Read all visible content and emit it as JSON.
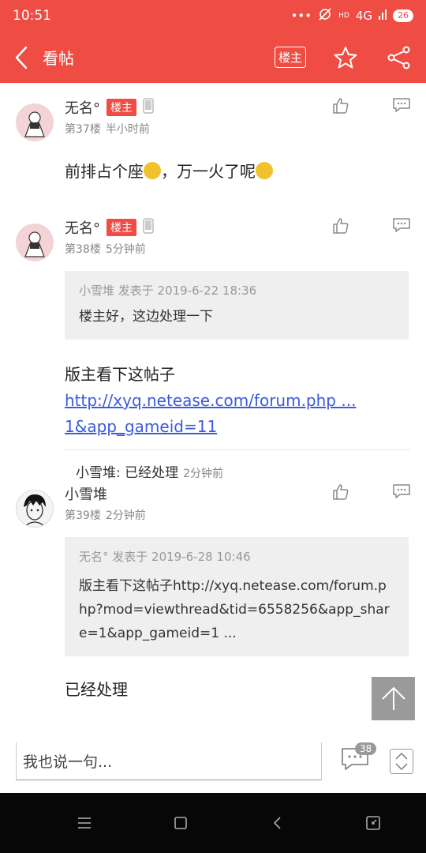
{
  "status": {
    "time": "10:51",
    "network": "4G",
    "battery": "26",
    "icons": [
      "dots-icon",
      "mute-alarm-icon",
      "hd-icon",
      "signal-icon",
      "battery-icon"
    ]
  },
  "header": {
    "title": "看帖",
    "louzhu_label": "楼主",
    "icons": [
      "back-icon",
      "star-icon",
      "share-icon"
    ],
    "color": "#ef4c44"
  },
  "posts": [
    {
      "name": "无名°",
      "badge": "楼主",
      "floor": "第37楼",
      "time": "半小时前",
      "text_a": "前排占个座",
      "text_b": "，万一火了呢"
    },
    {
      "name": "无名°",
      "badge": "楼主",
      "floor": "第38楼",
      "time": "5分钟前",
      "quote_head": "小雪堆 发表于 2019-6-22 18:36",
      "quote_body": "楼主好，这边处理一下",
      "text_prefix": "版主看下这帖子",
      "link": "http://xyq.netease.com/forum.php ... 1&app_gameid=11",
      "reply_author": "小雪堆",
      "reply_text": "已经处理",
      "reply_time": "2分钟前"
    },
    {
      "name": "小雪堆",
      "floor": "第39楼",
      "time": "2分钟前",
      "quote_head": "无名° 发表于 2019-6-28 10:46",
      "quote_body": "版主看下这帖子http://xyq.netease.com/forum.php?mod=viewthread&tid=6558256&app_share=1&app_gameid=1 ...",
      "text": "已经处理"
    }
  ],
  "composer": {
    "placeholder": "我也说一句...",
    "comment_count": "38"
  },
  "navbar": {
    "icons": [
      "menu-icon",
      "home-icon",
      "back-nav-icon",
      "recent-icon"
    ]
  }
}
